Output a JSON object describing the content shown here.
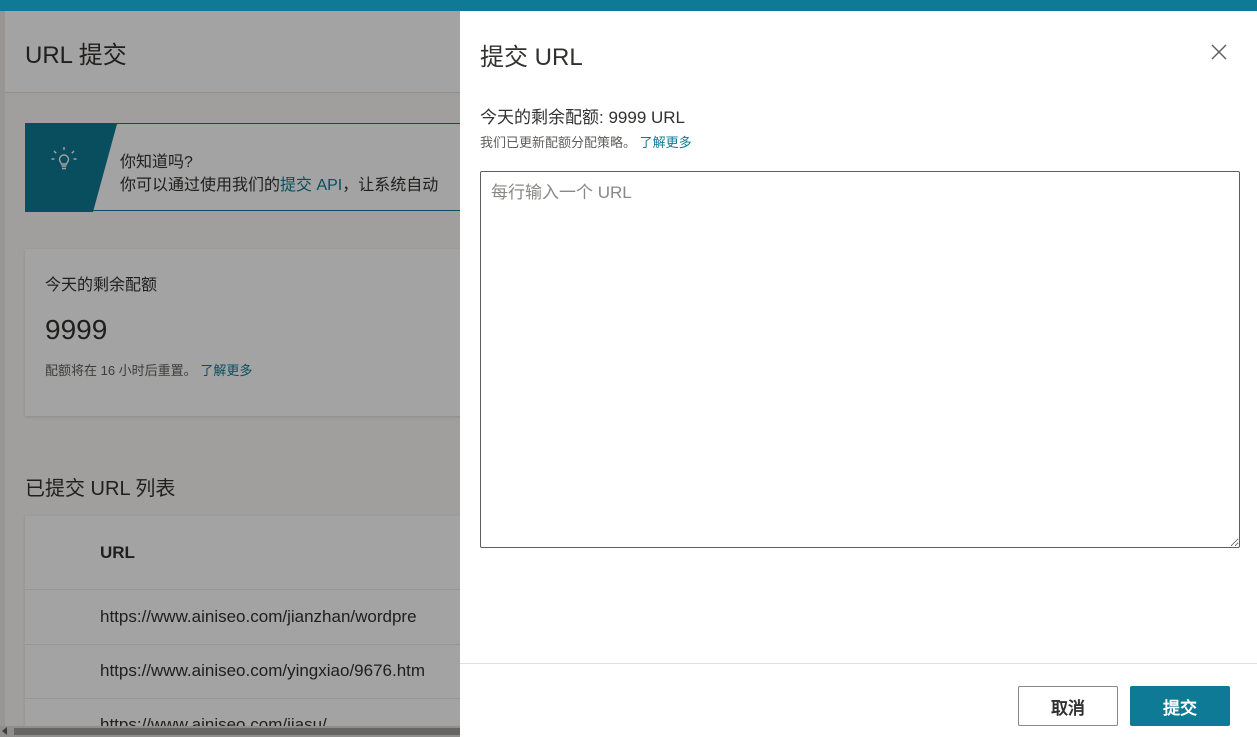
{
  "page": {
    "title": "URL 提交",
    "tip": {
      "icon": "lightbulb-icon",
      "title": "你知道吗?",
      "text_prefix": "你可以通过使用我们的",
      "link": "提交 API",
      "text_suffix": "，让系统自动"
    },
    "quota_card": {
      "title": "今天的剩余配额",
      "value": "9999",
      "note": "配额将在 16 小时后重置。",
      "link": "了解更多"
    },
    "list": {
      "heading": "已提交 URL 列表",
      "column_header": "URL",
      "rows": [
        "https://www.ainiseo.com/jianzhan/wordpre",
        "https://www.ainiseo.com/yingxiao/9676.htm",
        "https://www.ainiseo.com/jiasu/"
      ]
    }
  },
  "panel": {
    "title": "提交 URL",
    "close_icon": "close-icon",
    "quota_label": "今天的剩余配额: ",
    "quota_value": "9999",
    "quota_unit": " URL",
    "note": "我们已更新配额分配策略。",
    "note_link": "了解更多",
    "input_placeholder": "每行输入一个 URL",
    "input_value": "",
    "cancel_label": "取消",
    "submit_label": "提交"
  },
  "colors": {
    "accent": "#0f7a95",
    "overlay": "rgba(0,0,0,0.36)"
  }
}
